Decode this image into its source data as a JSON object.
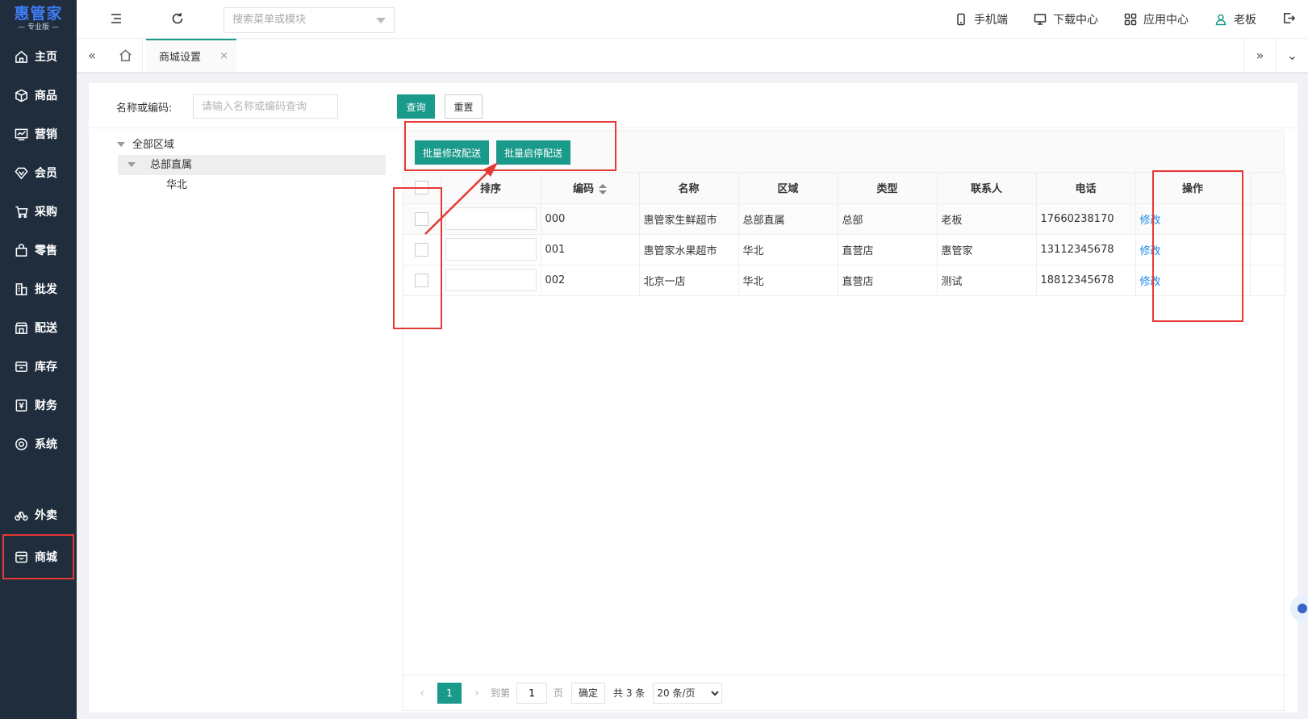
{
  "brand": {
    "name": "惠管家",
    "edition": "— 专业版 —"
  },
  "sidebar": {
    "items": [
      {
        "label": "主页",
        "icon": "home-icon"
      },
      {
        "label": "商品",
        "icon": "cube-icon"
      },
      {
        "label": "营销",
        "icon": "trend-chart-icon"
      },
      {
        "label": "会员",
        "icon": "diamond-icon"
      },
      {
        "label": "采购",
        "icon": "cart-icon"
      },
      {
        "label": "零售",
        "icon": "bag-icon"
      },
      {
        "label": "批发",
        "icon": "building-icon"
      },
      {
        "label": "配送",
        "icon": "store-icon"
      },
      {
        "label": "库存",
        "icon": "box-icon"
      },
      {
        "label": "财务",
        "icon": "yen-icon"
      },
      {
        "label": "系统",
        "icon": "circle-target-icon"
      }
    ],
    "extra_items": [
      {
        "label": "外卖",
        "icon": "bike-icon"
      },
      {
        "label": "商城",
        "icon": "shop-icon"
      }
    ]
  },
  "header": {
    "search_placeholder": "搜索菜单或模块",
    "links": {
      "mobile": "手机端",
      "download": "下载中心",
      "apps": "应用中心",
      "user": "老板"
    }
  },
  "tabs": {
    "active_label": "商城设置",
    "close_glyph": "×"
  },
  "filter": {
    "label": "名称或编码:",
    "placeholder": "请输入名称或编码查询",
    "query_label": "查询",
    "reset_label": "重置"
  },
  "tree": {
    "root": "全部区域",
    "child": "总部直属",
    "grandchild": "华北"
  },
  "toolbar": {
    "batch_edit_label": "批量修改配送",
    "batch_toggle_label": "批量启停配送"
  },
  "table": {
    "columns": [
      "排序",
      "编码",
      "名称",
      "区域",
      "类型",
      "联系人",
      "电话",
      "操作"
    ],
    "rows": [
      {
        "code": "000",
        "name": "惠管家生鲜超市",
        "region": "总部直属",
        "type": "总部",
        "contact": "老板",
        "phone": "17660238170",
        "action": "修改"
      },
      {
        "code": "001",
        "name": "惠管家水果超市",
        "region": "华北",
        "type": "直营店",
        "contact": "惠管家",
        "phone": "13112345678",
        "action": "修改"
      },
      {
        "code": "002",
        "name": "北京一店",
        "region": "华北",
        "type": "直营店",
        "contact": "测试",
        "phone": "18812345678",
        "action": "修改"
      }
    ]
  },
  "pager": {
    "current_page": "1",
    "goto_label": "到第",
    "goto_value": "1",
    "page_label": "页",
    "confirm_label": "确定",
    "total_label": "共 3 条",
    "page_size": "20 条/页"
  },
  "colors": {
    "sidebar_bg": "#1f2d3d",
    "accent": "#1a9a8a",
    "link": "#1e88e5",
    "annotation": "#e53935"
  }
}
